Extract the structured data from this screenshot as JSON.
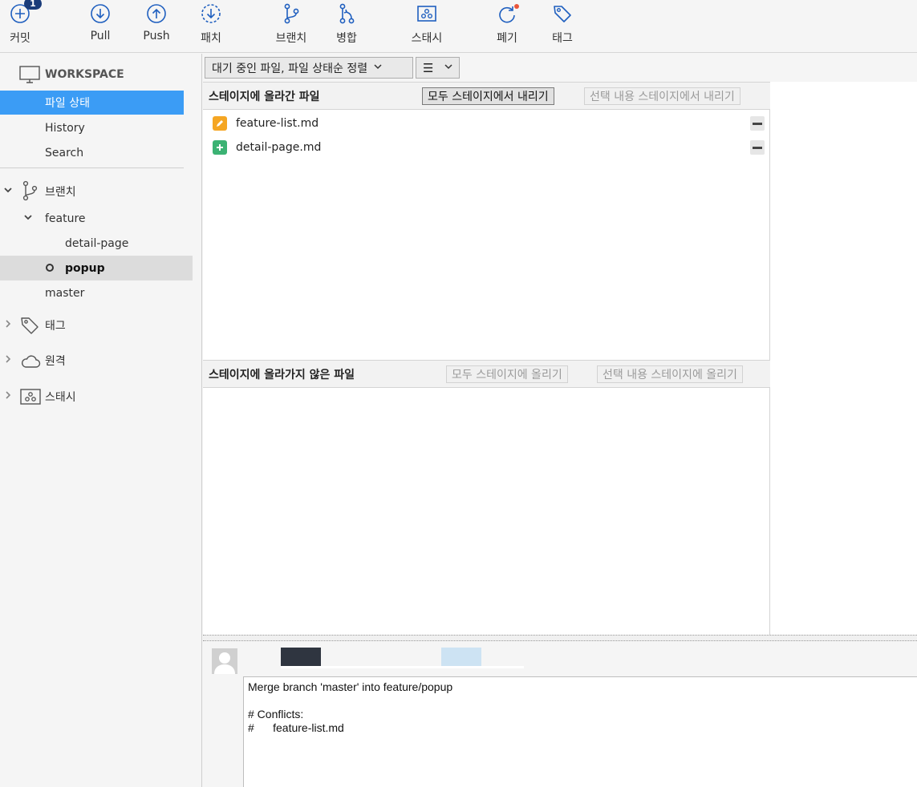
{
  "toolbar": {
    "commit": {
      "label": "커밋",
      "badge": "1"
    },
    "pull": {
      "label": "Pull"
    },
    "push": {
      "label": "Push"
    },
    "fetch": {
      "label": "패치"
    },
    "branch": {
      "label": "브랜치"
    },
    "merge": {
      "label": "병합"
    },
    "stash": {
      "label": "스태시"
    },
    "discard": {
      "label": "폐기"
    },
    "tag": {
      "label": "태그"
    }
  },
  "sidebar": {
    "workspace": "WORKSPACE",
    "workspace_items": [
      "파일 상태",
      "History",
      "Search"
    ],
    "branches": {
      "label": "브랜치",
      "folder": "feature",
      "feature_items": [
        "detail-page",
        "popup"
      ],
      "other": "master"
    },
    "tags": "태그",
    "remotes": "원격",
    "stashes": "스태시"
  },
  "filter": {
    "sort_label": "대기 중인 파일, 파일 상태순 정렬",
    "view_icon": "☰"
  },
  "staged": {
    "title": "스테이지에 올라간 파일",
    "unstage_all": "모두 스테이지에서 내리기",
    "unstage_selected": "선택 내용 스테이지에서 내리기",
    "files": [
      {
        "name": "feature-list.md",
        "status": "modified"
      },
      {
        "name": "detail-page.md",
        "status": "added"
      }
    ]
  },
  "unstaged": {
    "title": "스테이지에 올라가지 않은 파일",
    "stage_all": "모두 스테이지에 올리기",
    "stage_selected": "선택 내용 스테이지에 올리기"
  },
  "commit": {
    "message_lines": [
      "Merge branch 'master' into feature/popup",
      "",
      "# Conflicts:",
      "#\tfeature-list.md"
    ]
  },
  "colors": {
    "accent": "#3b9cf5",
    "icon_blue": "#1f5fbf",
    "modified": "#f5a623",
    "added": "#3bb273"
  }
}
